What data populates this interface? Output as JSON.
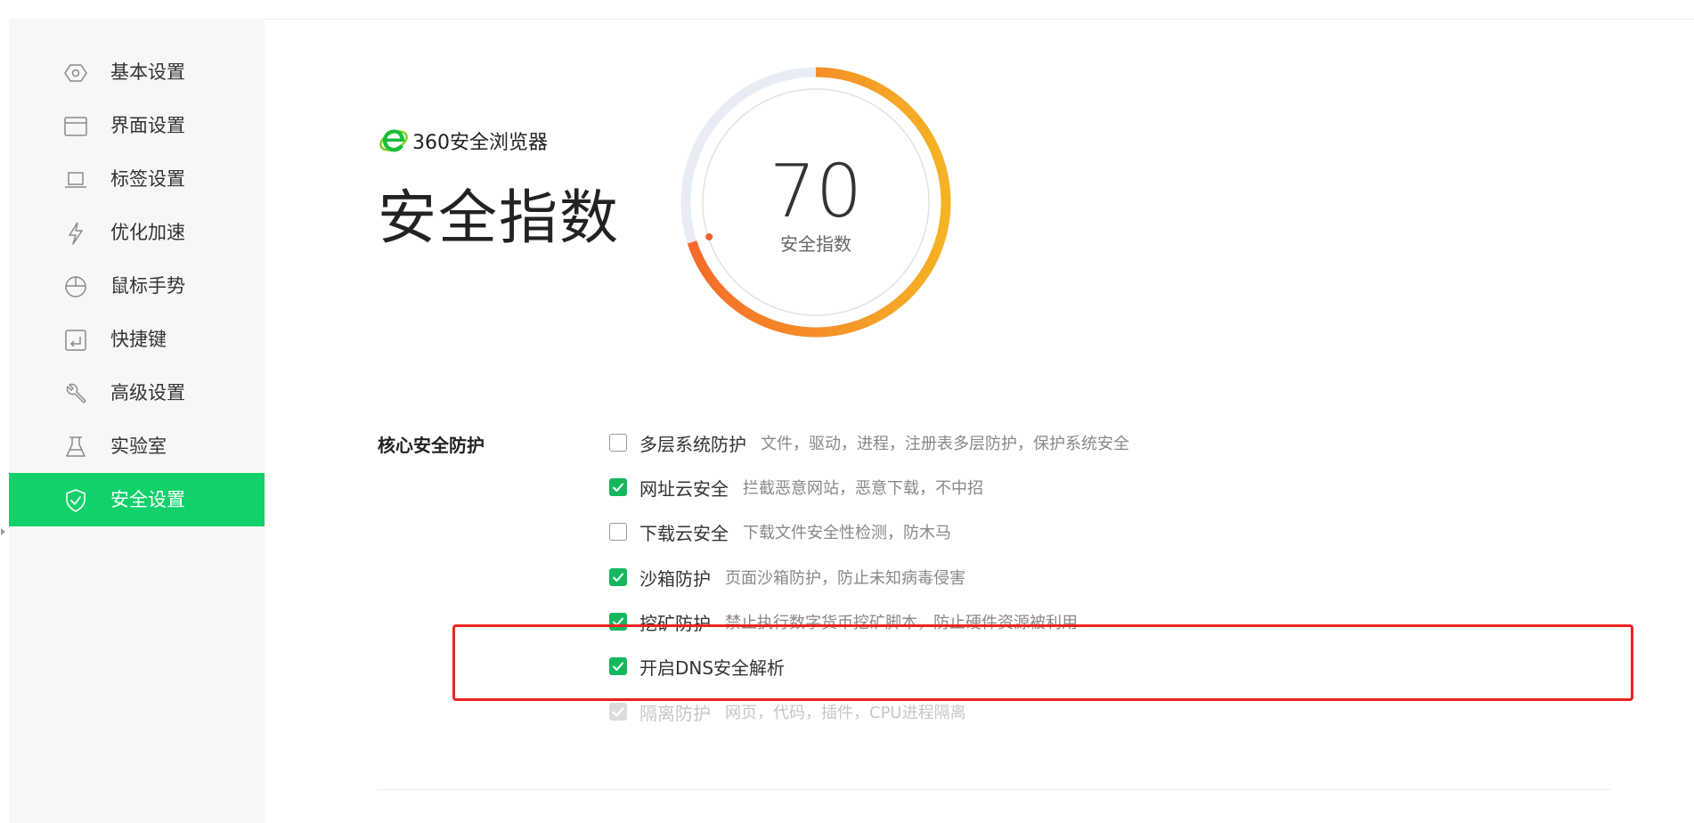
{
  "sidebar": {
    "items": [
      {
        "label": "基本设置",
        "icon": "hexagon-icon",
        "active": false
      },
      {
        "label": "界面设置",
        "icon": "window-icon",
        "active": false
      },
      {
        "label": "标签设置",
        "icon": "laptop-icon",
        "active": false
      },
      {
        "label": "优化加速",
        "icon": "lightning-icon",
        "active": false
      },
      {
        "label": "鼠标手势",
        "icon": "mouse-icon",
        "active": false
      },
      {
        "label": "快捷键",
        "icon": "keyboard-enter-icon",
        "active": false
      },
      {
        "label": "高级设置",
        "icon": "wrench-icon",
        "active": false
      },
      {
        "label": "实验室",
        "icon": "flask-icon",
        "active": false
      },
      {
        "label": "安全设置",
        "icon": "shield-check-icon",
        "active": true
      }
    ]
  },
  "header": {
    "brand_name": "360安全浏览器",
    "title": "安全指数"
  },
  "gauge": {
    "score": "70",
    "label": "安全指数",
    "fraction": 0.7,
    "colors": {
      "start": "#f5b324",
      "end": "#f56a2a",
      "track": "#e8edf5"
    }
  },
  "core": {
    "label": "核心安全防护",
    "options": [
      {
        "name": "多层系统防护",
        "desc": "文件，驱动，进程，注册表多层防护，保护系统安全",
        "checked": false,
        "disabled": false
      },
      {
        "name": "网址云安全",
        "desc": "拦截恶意网站，恶意下载，不中招",
        "checked": true,
        "disabled": false
      },
      {
        "name": "下载云安全",
        "desc": "下载文件安全性检测，防木马",
        "checked": false,
        "disabled": false
      },
      {
        "name": "沙箱防护",
        "desc": "页面沙箱防护，防止未知病毒侵害",
        "checked": true,
        "disabled": false
      },
      {
        "name": "挖矿防护",
        "desc": "禁止执行数字货币挖矿脚本，防止硬件资源被利用",
        "checked": true,
        "disabled": false
      },
      {
        "name": "开启DNS安全解析",
        "desc": "",
        "checked": true,
        "disabled": false
      },
      {
        "name": "隔离防护",
        "desc": "网页，代码，插件，CPU进程隔离",
        "checked": true,
        "disabled": true
      }
    ]
  },
  "accent_color": "#13d16a",
  "highlight_color": "#ee2222"
}
